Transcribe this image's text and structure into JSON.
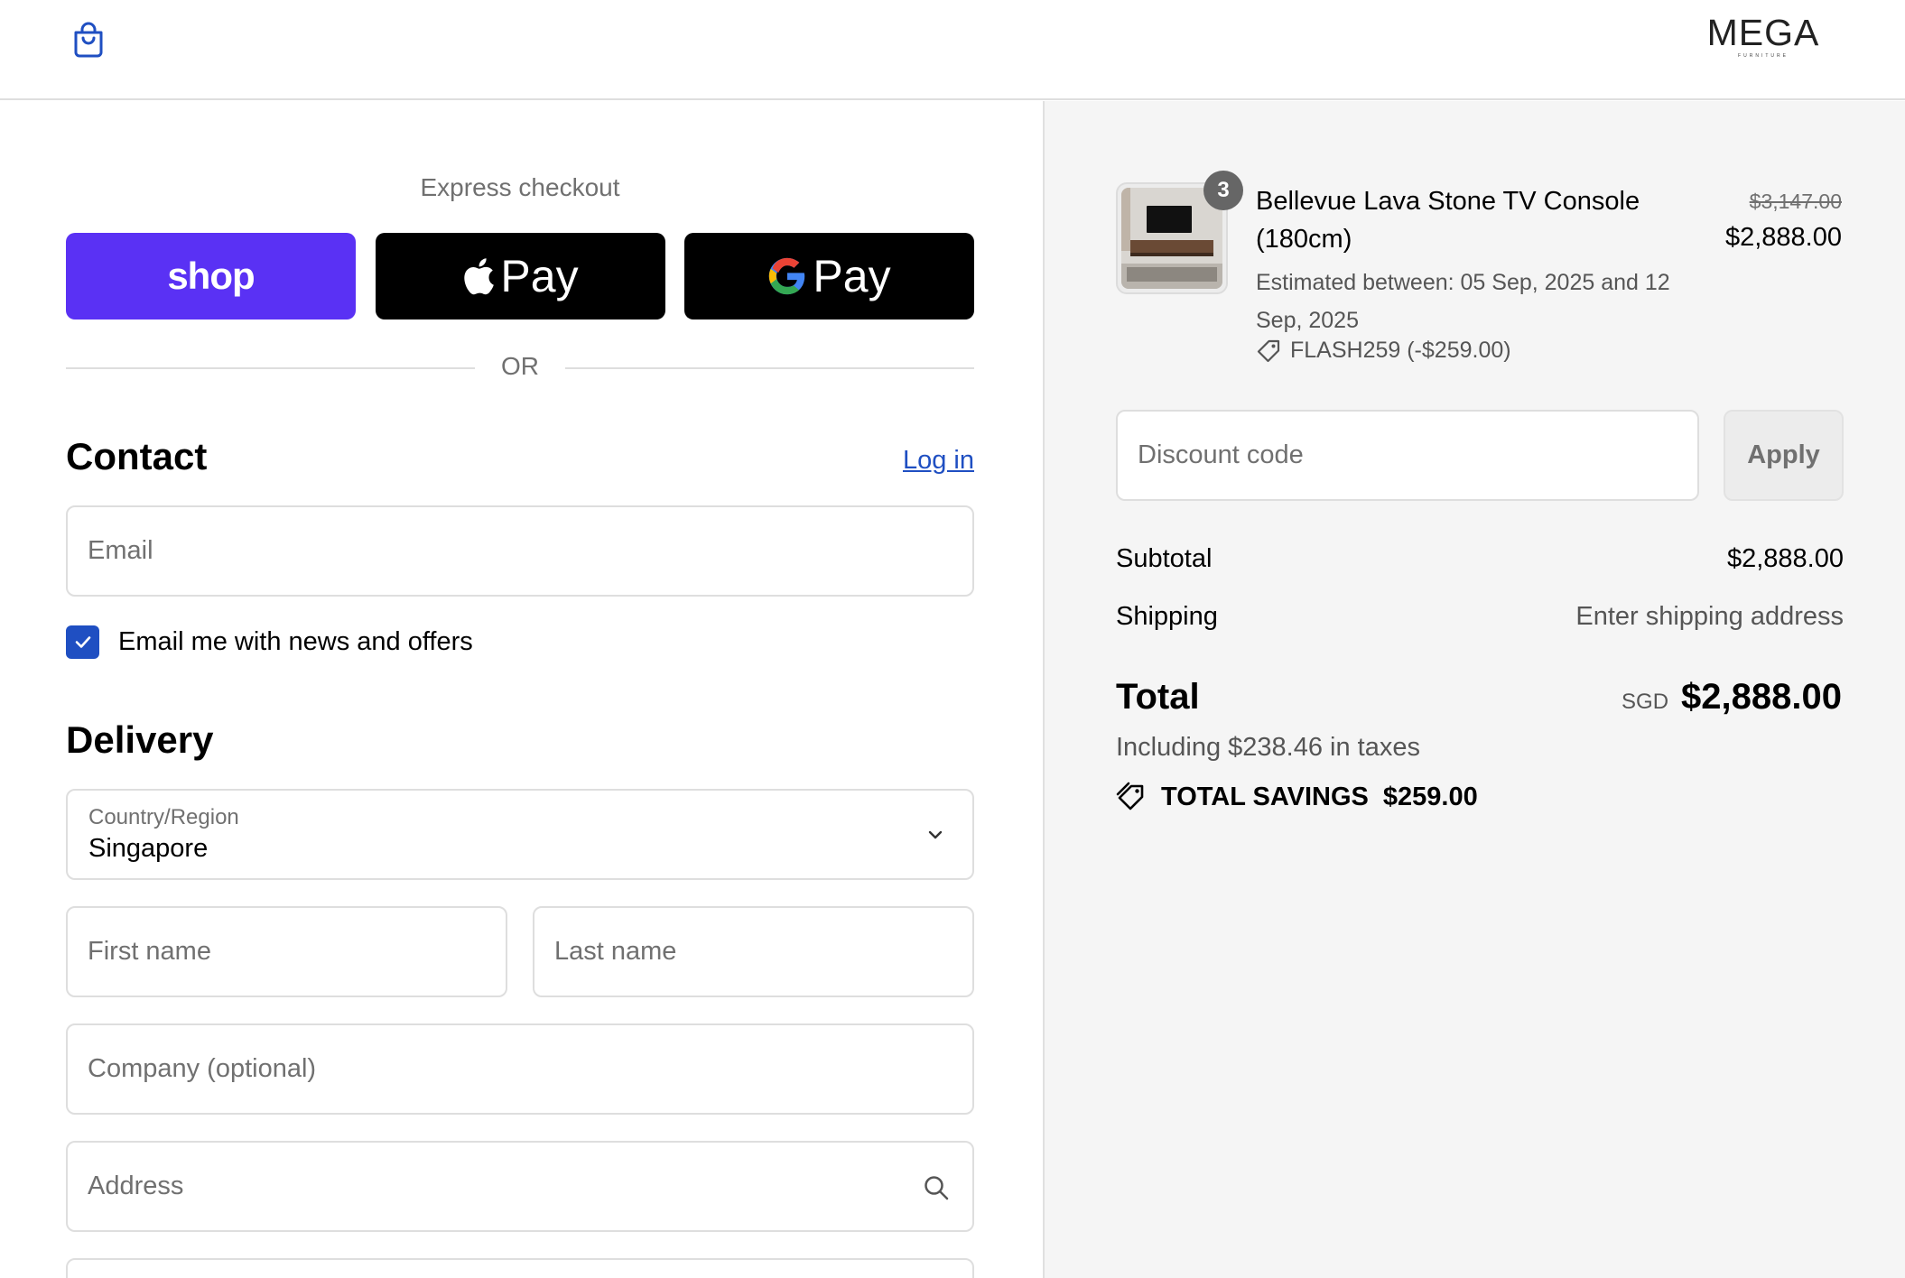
{
  "header": {
    "bag_icon": "shopping-bag-icon",
    "logo_text": "MEGA",
    "logo_subtext": "FURNITURE"
  },
  "express": {
    "title": "Express checkout",
    "shop_label": "shop",
    "apple_label": "Pay",
    "google_label": "Pay",
    "divider_text": "OR"
  },
  "contact": {
    "heading": "Contact",
    "login_label": "Log in",
    "email_placeholder": "Email",
    "newsletter_label": "Email me with news and offers",
    "newsletter_checked": true
  },
  "delivery": {
    "heading": "Delivery",
    "country_label": "Country/Region",
    "country_value": "Singapore",
    "first_name_placeholder": "First name",
    "last_name_placeholder": "Last name",
    "company_placeholder": "Company (optional)",
    "address_placeholder": "Address"
  },
  "summary": {
    "product": {
      "quantity": "3",
      "name": "Bellevue Lava Stone TV Console (180cm)",
      "eta": "Estimated between: 05 Sep, 2025 and 12 Sep, 2025",
      "discount_code": "FLASH259 (-$259.00)",
      "original_price": "$3,147.00",
      "price": "$2,888.00"
    },
    "discount_placeholder": "Discount code",
    "apply_label": "Apply",
    "subtotal_label": "Subtotal",
    "subtotal_value": "$2,888.00",
    "shipping_label": "Shipping",
    "shipping_value": "Enter shipping address",
    "total_label": "Total",
    "total_currency": "SGD",
    "total_value": "$2,888.00",
    "taxes_text": "Including $238.46 in taxes",
    "savings_label": "TOTAL SAVINGS",
    "savings_value": "$259.00"
  },
  "colors": {
    "shop_pay": "#5a31f4",
    "link_blue": "#1f4fc2",
    "summary_bg": "#f5f5f5"
  }
}
